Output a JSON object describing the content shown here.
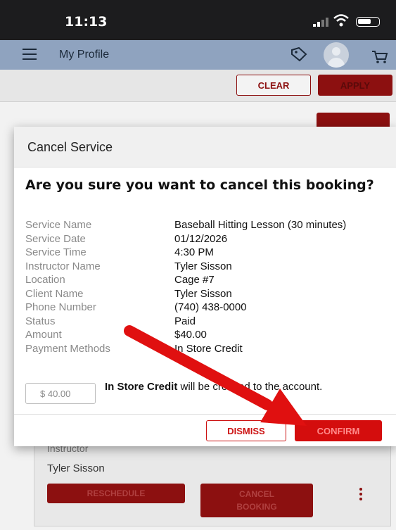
{
  "status_bar": {
    "time": "11:13"
  },
  "header": {
    "title": "My Profile"
  },
  "filters": {
    "clear_label": "CLEAR",
    "apply_label": "APPLY"
  },
  "modal": {
    "title": "Cancel Service",
    "question": "Are you sure you want to cancel this booking?",
    "rows": [
      {
        "label": "Service Name",
        "value": "Baseball Hitting Lesson (30 minutes)"
      },
      {
        "label": "Service Date",
        "value": "01/12/2026"
      },
      {
        "label": "Service Time",
        "value": "4:30 PM"
      },
      {
        "label": "Instructor Name",
        "value": "Tyler Sisson"
      },
      {
        "label": "Location",
        "value": "Cage #7"
      },
      {
        "label": "Client Name",
        "value": "Tyler Sisson"
      },
      {
        "label": "Phone Number",
        "value": "(740) 438-0000"
      },
      {
        "label": "Status",
        "value": "Paid"
      },
      {
        "label": "Amount",
        "value": "$40.00"
      },
      {
        "label": "Payment Methods",
        "value": "In Store Credit"
      }
    ],
    "credit_amount": "$ 40.00",
    "credit_text_bold": "In Store Credit",
    "credit_text_rest": " will be credited to the account.",
    "dismiss_label": "DISMISS",
    "confirm_label": "CONFIRM"
  },
  "booking_card": {
    "instructor_label": "Instructor",
    "instructor_name": "Tyler Sisson",
    "reschedule_label": "RESCHEDULE",
    "cancel_label": "CANCEL BOOKING"
  },
  "colors": {
    "accent": "#d40d0d",
    "header": "#8fa3bf",
    "annotation_arrow": "#e01010"
  }
}
